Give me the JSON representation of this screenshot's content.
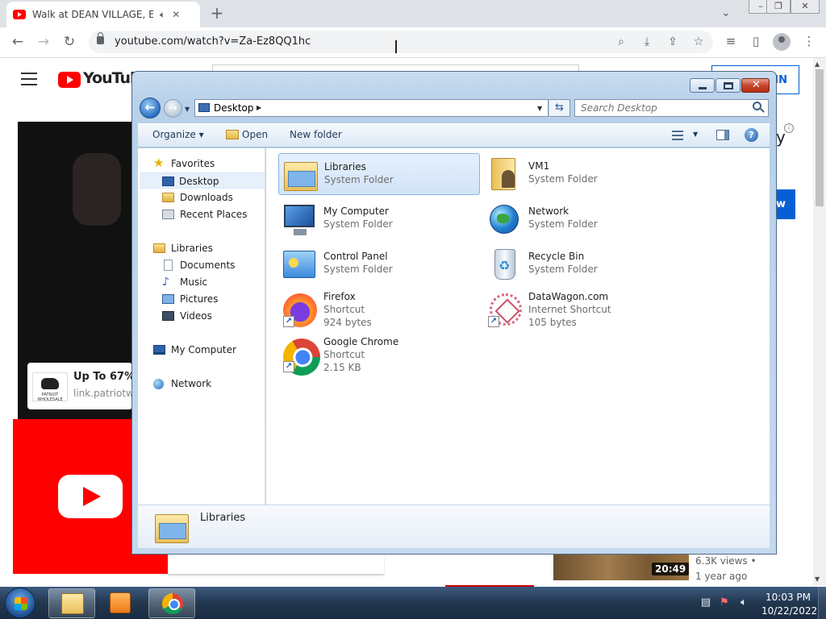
{
  "browser": {
    "tab_title": "Walk at DEAN VILLAGE, Edin",
    "url": "youtube.com/watch?v=Za-Ez8QQ1hc"
  },
  "youtube": {
    "logo_text": "YouTube",
    "signin_partial": "IN",
    "ad_title": "Up To 67% O",
    "ad_link": "link.patriotw",
    "ad_logo_text": "PATRIOT WHOLESALE",
    "blue_btn_partial": "w",
    "letter_partial": "y",
    "duration": "20:49",
    "views": "6.3K views •",
    "age": "1 year ago"
  },
  "explorer": {
    "address": "Desktop",
    "search_placeholder": "Search Desktop",
    "commands": {
      "organize": "Organize ▾",
      "open": "Open",
      "new_folder": "New folder"
    },
    "nav": {
      "favorites": "Favorites",
      "desktop": "Desktop",
      "downloads": "Downloads",
      "recent": "Recent Places",
      "libraries": "Libraries",
      "documents": "Documents",
      "music": "Music",
      "pictures": "Pictures",
      "videos": "Videos",
      "computer": "My Computer",
      "network": "Network"
    },
    "files": [
      {
        "name": "Libraries",
        "type": "System Folder"
      },
      {
        "name": "VM1",
        "type": "System Folder"
      },
      {
        "name": "My Computer",
        "type": "System Folder"
      },
      {
        "name": "Network",
        "type": "System Folder"
      },
      {
        "name": "Control Panel",
        "type": "System Folder"
      },
      {
        "name": "Recycle Bin",
        "type": "System Folder"
      },
      {
        "name": "Firefox",
        "type": "Shortcut",
        "size": "924 bytes"
      },
      {
        "name": "DataWagon.com",
        "type": "Internet Shortcut",
        "size": "105 bytes"
      },
      {
        "name": "Google Chrome",
        "type": "Shortcut",
        "size": "2.15 KB"
      }
    ],
    "details_name": "Libraries"
  },
  "taskbar": {
    "time": "10:03 PM",
    "date": "10/22/2022"
  }
}
